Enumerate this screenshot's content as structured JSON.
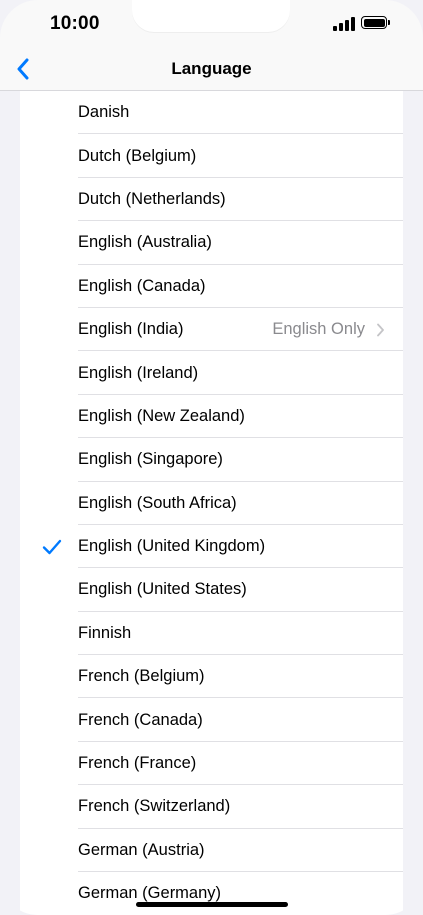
{
  "status_bar": {
    "time": "10:00"
  },
  "nav": {
    "title": "Language",
    "back_icon": "chevron-left-icon"
  },
  "colors": {
    "accent": "#007aff",
    "detail": "#8a8a8e"
  },
  "languages": [
    {
      "label": "Danish",
      "checked": false,
      "detail": ""
    },
    {
      "label": "Dutch (Belgium)",
      "checked": false,
      "detail": ""
    },
    {
      "label": "Dutch (Netherlands)",
      "checked": false,
      "detail": ""
    },
    {
      "label": "English (Australia)",
      "checked": false,
      "detail": ""
    },
    {
      "label": "English (Canada)",
      "checked": false,
      "detail": ""
    },
    {
      "label": "English (India)",
      "checked": false,
      "detail": "English Only"
    },
    {
      "label": "English (Ireland)",
      "checked": false,
      "detail": ""
    },
    {
      "label": "English (New Zealand)",
      "checked": false,
      "detail": ""
    },
    {
      "label": "English (Singapore)",
      "checked": false,
      "detail": ""
    },
    {
      "label": "English (South Africa)",
      "checked": false,
      "detail": ""
    },
    {
      "label": "English (United Kingdom)",
      "checked": true,
      "detail": ""
    },
    {
      "label": "English (United States)",
      "checked": false,
      "detail": ""
    },
    {
      "label": "Finnish",
      "checked": false,
      "detail": ""
    },
    {
      "label": "French (Belgium)",
      "checked": false,
      "detail": ""
    },
    {
      "label": "French (Canada)",
      "checked": false,
      "detail": ""
    },
    {
      "label": "French (France)",
      "checked": false,
      "detail": ""
    },
    {
      "label": "French (Switzerland)",
      "checked": false,
      "detail": ""
    },
    {
      "label": "German (Austria)",
      "checked": false,
      "detail": ""
    },
    {
      "label": "German (Germany)",
      "checked": false,
      "detail": ""
    }
  ]
}
